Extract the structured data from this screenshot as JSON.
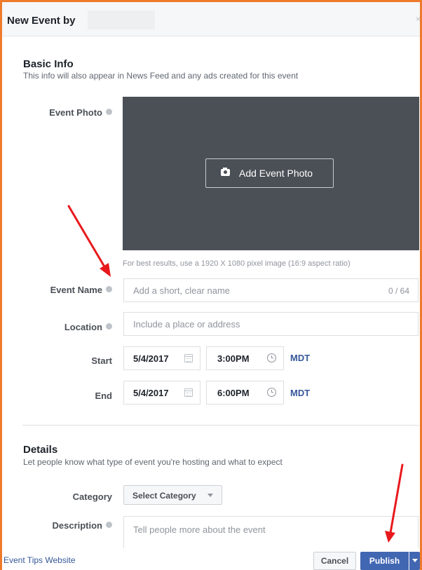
{
  "header": {
    "title": "New Event by",
    "close_glyph": "×"
  },
  "basic_info": {
    "title": "Basic Info",
    "subtitle": "This info will also appear in News Feed and any ads created for this event"
  },
  "event_photo": {
    "label": "Event Photo",
    "button_label": "Add Event Photo",
    "hint": "For best results, use a 1920 X 1080 pixel image (16:9 aspect ratio)"
  },
  "event_name": {
    "label": "Event Name",
    "placeholder": "Add a short, clear name",
    "counter": "0 / 64"
  },
  "location": {
    "label": "Location",
    "placeholder": "Include a place or address"
  },
  "start": {
    "label": "Start",
    "date": "5/4/2017",
    "time": "3:00PM",
    "timezone": "MDT"
  },
  "end": {
    "label": "End",
    "date": "5/4/2017",
    "time": "6:00PM",
    "timezone": "MDT"
  },
  "details": {
    "title": "Details",
    "subtitle": "Let people know what type of event you're hosting and what to expect"
  },
  "category": {
    "label": "Category",
    "select_label": "Select Category"
  },
  "description": {
    "label": "Description",
    "placeholder": "Tell people more about the event"
  },
  "footer": {
    "tips_link": "Event Tips Website",
    "cancel_label": "Cancel",
    "publish_label": "Publish"
  },
  "colors": {
    "frame_border": "#ee7a2c",
    "annotation_arrow": "#e8191c",
    "primary_button": "#4267b2",
    "link": "#365899",
    "photo_area": "#4b4f56"
  },
  "icons": [
    "info-icon",
    "camera-icon",
    "calendar-icon",
    "clock-icon",
    "chevron-down-icon",
    "close-icon"
  ]
}
